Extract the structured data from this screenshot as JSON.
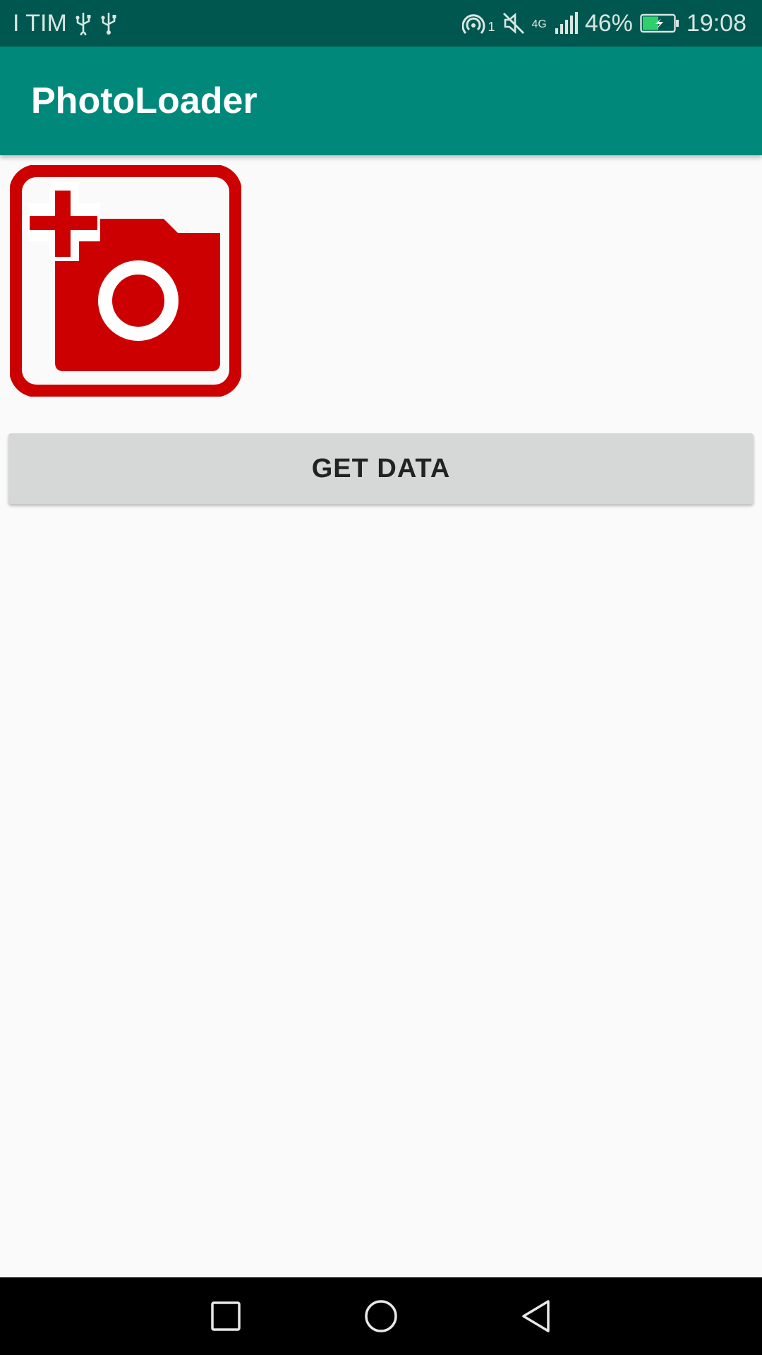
{
  "status_bar": {
    "carrier": "I TIM",
    "signal_sup": "1",
    "network": "4G",
    "battery_percent": "46%",
    "time": "19:08",
    "icons": [
      "usb-icon",
      "usb-icon",
      "hotspot-icon",
      "mute-icon",
      "signal-icon",
      "battery-charging-icon"
    ]
  },
  "app_bar": {
    "title": "PhotoLoader",
    "color": "#00897b"
  },
  "main": {
    "image_icon": "add-photo-icon",
    "image_color": "#cc0000",
    "button_label": "GET DATA"
  },
  "nav_bar": {
    "buttons": [
      "recents-icon",
      "home-icon",
      "back-icon"
    ]
  }
}
